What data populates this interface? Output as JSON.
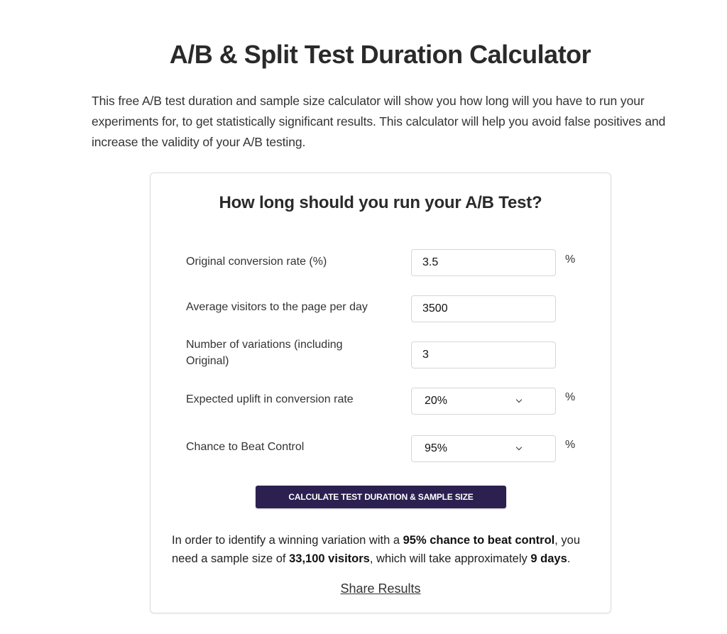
{
  "page": {
    "title": "A/B & Split Test Duration Calculator",
    "intro": "This free A/B test duration and sample size calculator will show you how long will you have to run your experiments for, to get statistically significant results. This calculator will help you avoid false positives and increase the validity of your A/B testing."
  },
  "calculator": {
    "title": "How long should you run your A/B Test?",
    "fields": [
      {
        "label": "Original conversion rate (%)",
        "value": "3.5",
        "unit": "%",
        "type": "input"
      },
      {
        "label": "Average visitors to the page per day",
        "value": "3500",
        "unit": "",
        "type": "input"
      },
      {
        "label": "Number of variations (including Original)",
        "value": "3",
        "unit": "",
        "type": "input"
      },
      {
        "label": "Expected uplift in conversion rate",
        "value": "20%",
        "unit": "%",
        "type": "select"
      },
      {
        "label": "Chance to Beat Control",
        "value": "95%",
        "unit": "%",
        "type": "select"
      }
    ],
    "button_label": "CALCULATE TEST DURATION & SAMPLE SIZE",
    "button_color": "#2c2050",
    "result": {
      "part1": "In order to identify a winning variation with a ",
      "bold1": "95% chance to beat control",
      "part2": ", you need a sample size of ",
      "bold2": "33,100 visitors",
      "part3": ", which will take approximately ",
      "bold3": "9 days",
      "part4": "."
    },
    "share_label": "Share Results"
  }
}
